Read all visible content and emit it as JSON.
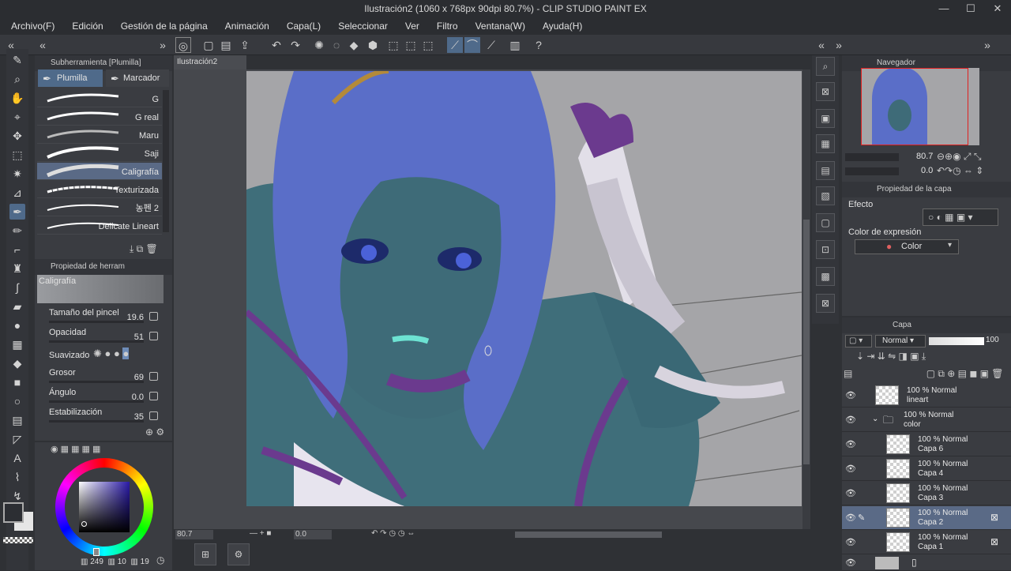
{
  "window": {
    "title": "Ilustración2 (1060 x 768px 90dpi 80.7%) - CLIP STUDIO PAINT EX"
  },
  "menu": [
    "Archivo(F)",
    "Edición",
    "Gestión de la página",
    "Animación",
    "Capa(L)",
    "Seleccionar",
    "Ver",
    "Filtro",
    "Ventana(W)",
    "Ayuda(H)"
  ],
  "subtool": {
    "header": "Subherramienta [Plumilla]",
    "tab1": "Plumilla",
    "tab2": "Marcador",
    "brushes": [
      "G",
      "G real",
      "Maru",
      "Saji",
      "Caligrafía",
      "Texturizada",
      "농펜 2",
      "Delicate Lineart"
    ]
  },
  "toolprop": {
    "header": "Propiedad de herram",
    "preset": "Caligrafía",
    "size_label": "Tamaño del pincel",
    "size_value": "19.6",
    "opacity_label": "Opacidad",
    "opacity_value": "51",
    "smooth_label": "Suavizado",
    "thickness_label": "Grosor",
    "thickness_value": "69",
    "angle_label": "Ángulo",
    "angle_value": "0.0",
    "stab_label": "Estabilización",
    "stab_value": "35"
  },
  "color": {
    "main": "#2c2e33",
    "sub": "#e6e6e6",
    "h": "249",
    "s": "10",
    "v": "19"
  },
  "document": {
    "tab": "Ilustración2",
    "zoom": "80.7",
    "angle": "0.0"
  },
  "navigator": {
    "header": "Navegador",
    "zoom": "80.7",
    "rotate": "0.0"
  },
  "layerprop": {
    "header": "Propiedad de la capa",
    "effect": "Efecto",
    "expr_label": "Color de expresión",
    "expr_value": "Color"
  },
  "layers": {
    "header": "Capa",
    "blend": "Normal",
    "opacity": "100",
    "items": [
      {
        "t1": "100 % Normal",
        "t2": "lineart"
      },
      {
        "t1": "100 % Normal",
        "t2": "color"
      },
      {
        "t1": "100 % Normal",
        "t2": "Capa 6"
      },
      {
        "t1": "100 % Normal",
        "t2": "Capa 4"
      },
      {
        "t1": "100 % Normal",
        "t2": "Capa 3"
      },
      {
        "t1": "100 % Normal",
        "t2": "Capa 2"
      },
      {
        "t1": "100 % Normal",
        "t2": "Capa 1"
      }
    ]
  }
}
